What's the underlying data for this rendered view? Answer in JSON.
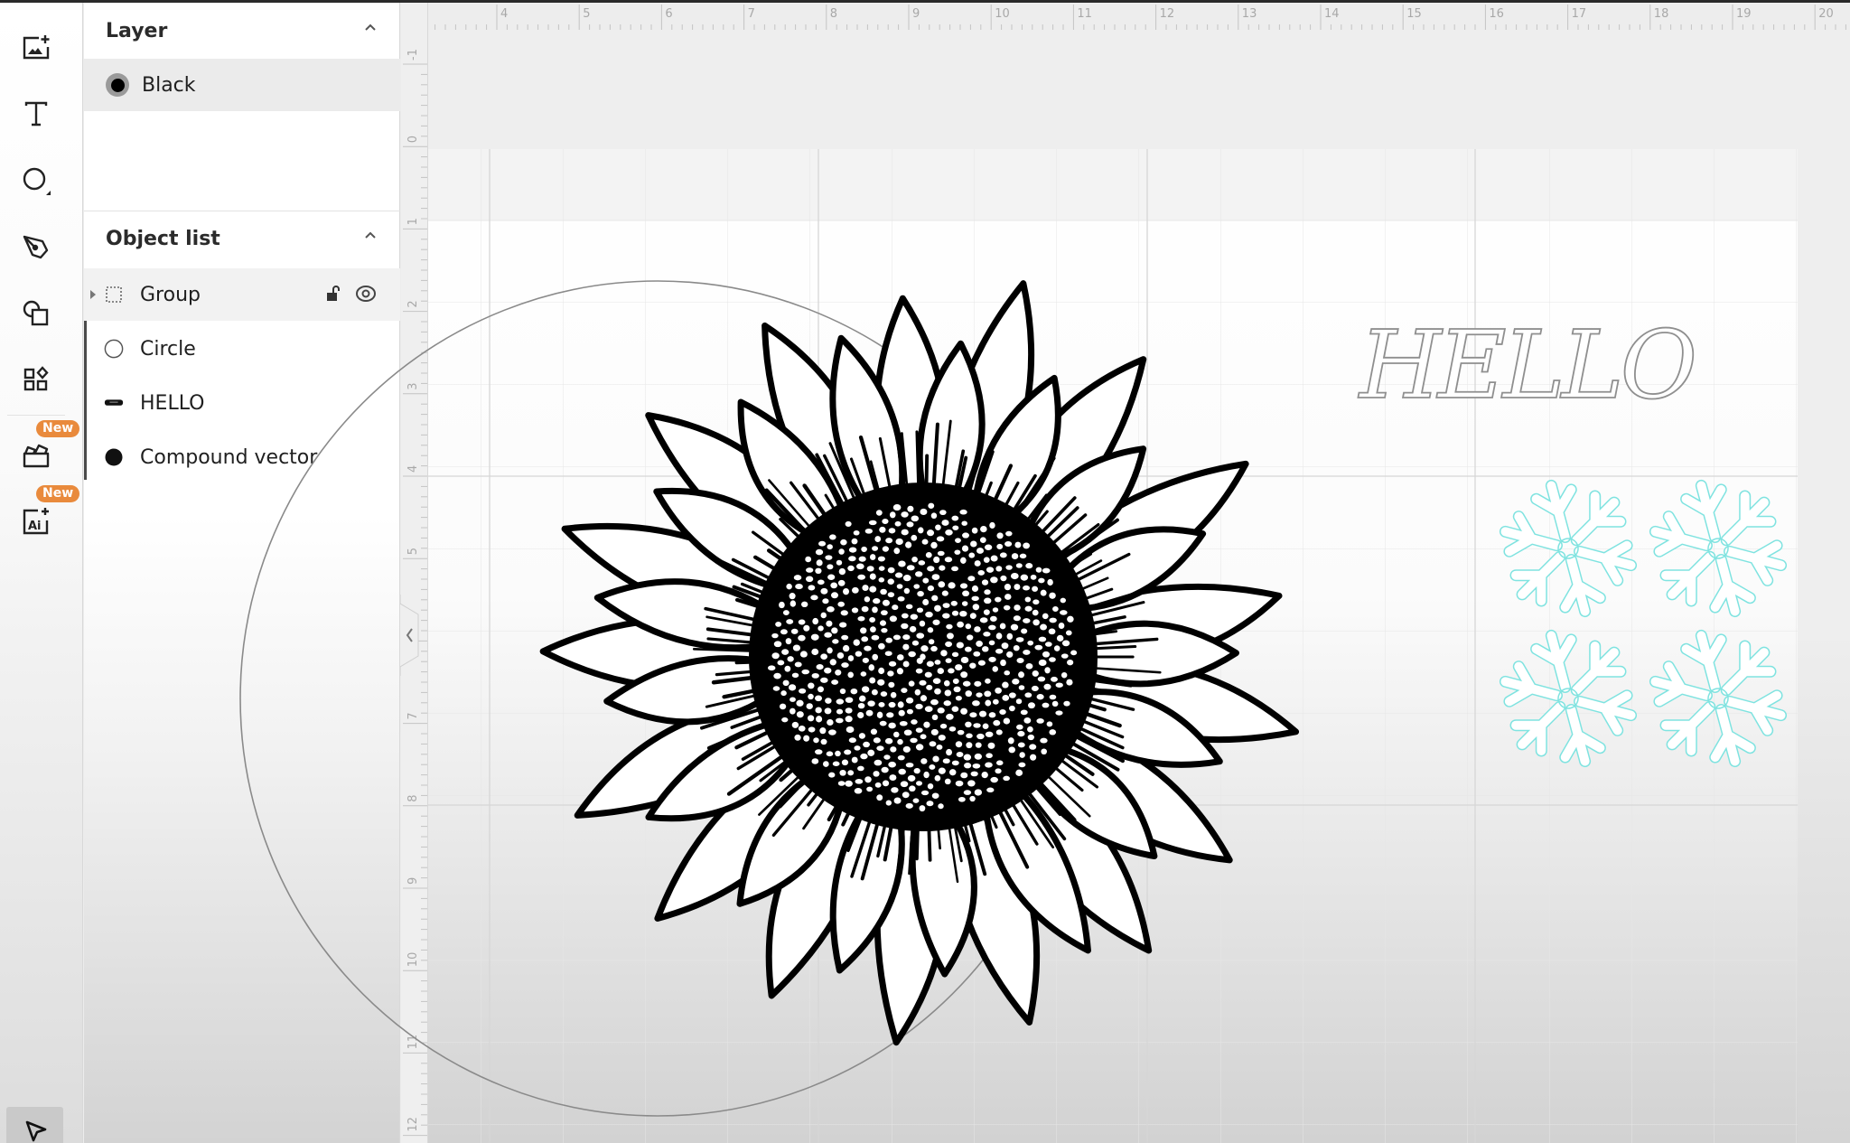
{
  "toolbar": {
    "tools": [
      {
        "name": "upload-image",
        "icon": "image-plus-icon"
      },
      {
        "name": "text",
        "icon": "text-icon"
      },
      {
        "name": "shapes",
        "icon": "circle-shape-icon"
      },
      {
        "name": "pen",
        "icon": "pen-tool-icon"
      },
      {
        "name": "combine",
        "icon": "shapes-overlap-icon"
      },
      {
        "name": "elements",
        "icon": "grid-elements-icon"
      },
      {
        "name": "projects",
        "icon": "folder-box-icon",
        "badge": "New"
      },
      {
        "name": "ai",
        "icon": "ai-generate-icon",
        "badge": "New"
      },
      {
        "name": "select",
        "icon": "cursor-arrow-icon"
      }
    ]
  },
  "layers_panel": {
    "layer_section": {
      "title": "Layer",
      "layers": [
        {
          "label": "Black",
          "color": "#000000",
          "selected": true
        }
      ]
    },
    "object_section": {
      "title": "Object list",
      "objects": [
        {
          "label": "Group",
          "icon": "group-dashed-square-icon",
          "expandable": true,
          "locked": false,
          "visible": true
        },
        {
          "label": "Circle",
          "icon": "circle-outline-icon"
        },
        {
          "label": "HELLO",
          "icon": "text-swatch-icon"
        },
        {
          "label": "Compound vector",
          "icon": "filled-blob-icon"
        }
      ]
    }
  },
  "canvas": {
    "ruler_h_labels": [
      "4",
      "5",
      "6",
      "7",
      "8",
      "9",
      "10",
      "11",
      "12",
      "13",
      "14",
      "15",
      "16",
      "17",
      "18",
      "19",
      "20"
    ],
    "ruler_v_labels": [
      "-1",
      "0",
      "1",
      "2",
      "3",
      "4",
      "5",
      "6",
      "7",
      "8",
      "9",
      "10",
      "11",
      "12"
    ],
    "objects": {
      "sunflower": {
        "type": "compound-vector",
        "color": "#000000"
      },
      "circle": {
        "type": "circle",
        "color": "#7a7a7a"
      },
      "hello_text": {
        "text": "HELLO",
        "color": "#8a8a8a"
      },
      "snowflakes": {
        "count": 4,
        "color": "#7fe3e0"
      }
    }
  },
  "colors": {
    "badge": "#e98a3c",
    "selected_row": "#ebebeb",
    "snowflake": "#7fe3e0"
  }
}
